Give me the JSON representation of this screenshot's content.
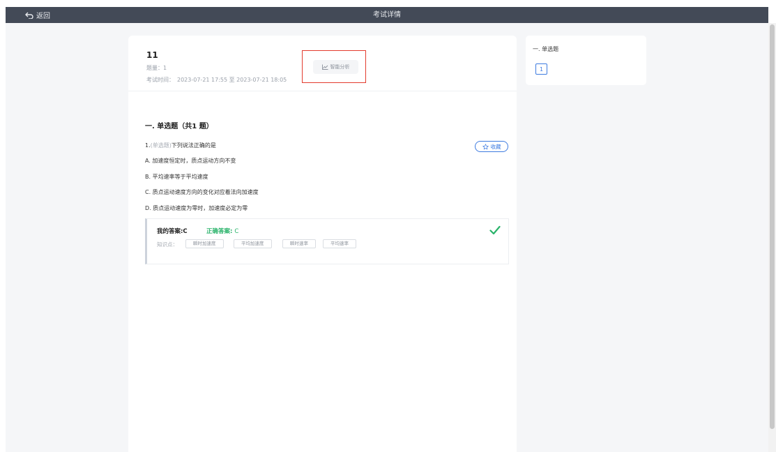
{
  "topbar": {
    "back_label": "返回",
    "title": "考试详情"
  },
  "exam": {
    "title": "11",
    "question_count": "题量：1",
    "time_label": "考试时间：",
    "time_range": "2023-07-21 17:55 至 2023-07-21 18:05",
    "analysis_button": "智能分析"
  },
  "section": {
    "title": "一. 单选题（共1 题）"
  },
  "question": {
    "number": "1.",
    "type": "(单选题)",
    "text": "下列说法正确的是",
    "favorite_label": "收藏",
    "options": [
      "A. 加速度恒定时，质点运动方向不变",
      "B. 平均速率等于平均速度",
      "C. 质点运动速度方向的变化对应着法向加速度",
      "D. 质点运动速度为零时，加速度必定为零"
    ]
  },
  "answer": {
    "my_answer": "我的答案:C",
    "correct_label": "正确答案:",
    "correct_value": "C",
    "knowledge_label": "知识点：",
    "knowledge_points": [
      "瞬时加速度",
      "平均加速度",
      "瞬时速率",
      "平均速率"
    ]
  },
  "sidebar": {
    "section_title": "一. 单选题",
    "numbers": [
      "1"
    ]
  },
  "colors": {
    "topbar": "#434a57",
    "accent_blue": "#3d7be0",
    "correct_green": "#29b36a",
    "highlight_red": "#e33b2d",
    "background": "#f5f6f8"
  },
  "icons": {
    "back": "back-arrow-icon",
    "analysis": "line-chart-icon",
    "favorite": "star-outline-icon",
    "correct": "checkmark-icon"
  }
}
